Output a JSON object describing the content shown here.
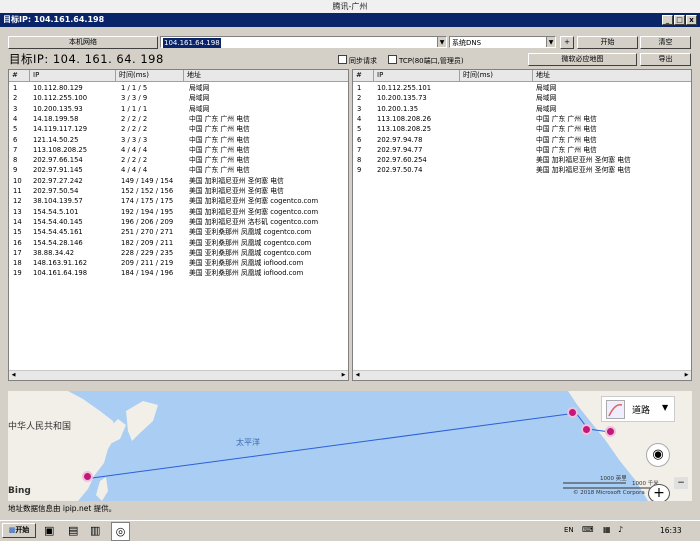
{
  "outer_title": "腾讯-广州",
  "window": {
    "title": "目标IP:  104.161.64.198",
    "controls": [
      "_",
      "□",
      "x"
    ]
  },
  "toolbar": {
    "local_network_label": "本机网络",
    "ip_input_value": "104.161.64.198",
    "dns_select_value": "系统DNS",
    "plus_label": "+",
    "start_label": "开始",
    "clear_label": "清空",
    "bing_map_label": "微软必应地图",
    "export_label": "导出",
    "sync_request_label": "同步请求",
    "tcp_label": "TCP(80端口,管理员)"
  },
  "target_display": "目标IP:  104. 161. 64. 198",
  "left_table": {
    "headers": [
      "#",
      "IP",
      "时间(ms)",
      "地址"
    ],
    "rows": [
      {
        "n": "1",
        "ip": "10.112.80.129",
        "time": "1 / 1 / 5",
        "addr": "局域网"
      },
      {
        "n": "2",
        "ip": "10.112.255.100",
        "time": "3 / 3 / 9",
        "addr": "局域网"
      },
      {
        "n": "3",
        "ip": "10.200.135.93",
        "time": "1 / 1 / 1",
        "addr": "局域网"
      },
      {
        "n": "4",
        "ip": "14.18.199.58",
        "time": "2 / 2 / 2",
        "addr": "中国 广东 广州 电信"
      },
      {
        "n": "5",
        "ip": "14.119.117.129",
        "time": "2 / 2 / 2",
        "addr": "中国 广东 广州 电信"
      },
      {
        "n": "6",
        "ip": "121.14.50.25",
        "time": "3 / 3 / 3",
        "addr": "中国 广东 广州 电信"
      },
      {
        "n": "7",
        "ip": "113.108.208.25",
        "time": "4 / 4 / 4",
        "addr": "中国 广东 广州 电信"
      },
      {
        "n": "8",
        "ip": "202.97.66.154",
        "time": "2 / 2 / 2",
        "addr": "中国 广东 广州 电信"
      },
      {
        "n": "9",
        "ip": "202.97.91.145",
        "time": "4 / 4 / 4",
        "addr": "中国 广东 广州 电信"
      },
      {
        "n": "10",
        "ip": "202.97.27.242",
        "time": "149 / 149 / 154",
        "addr": "美国 加利福尼亚州 圣何塞 电信"
      },
      {
        "n": "11",
        "ip": "202.97.50.54",
        "time": "152 / 152 / 156",
        "addr": "美国 加利福尼亚州 圣何塞 电信"
      },
      {
        "n": "12",
        "ip": "38.104.139.57",
        "time": "174 / 175 / 175",
        "addr": "美国 加利福尼亚州 圣何塞 cogentco.com"
      },
      {
        "n": "13",
        "ip": "154.54.5.101",
        "time": "192 / 194 / 195",
        "addr": "美国 加利福尼亚州 圣何塞 cogentco.com"
      },
      {
        "n": "14",
        "ip": "154.54.40.145",
        "time": "196 / 206 / 209",
        "addr": "美国 加利福尼亚州 洛杉矶 cogentco.com"
      },
      {
        "n": "15",
        "ip": "154.54.45.161",
        "time": "251 / 270 / 271",
        "addr": "美国 亚利桑那州 凤凰城 cogentco.com"
      },
      {
        "n": "16",
        "ip": "154.54.28.146",
        "time": "182 / 209 / 211",
        "addr": "美国 亚利桑那州 凤凰城 cogentco.com"
      },
      {
        "n": "17",
        "ip": "38.88.34.42",
        "time": "228 / 229 / 235",
        "addr": "美国 亚利桑那州 凤凰城 cogentco.com"
      },
      {
        "n": "18",
        "ip": "148.163.91.162",
        "time": "209 / 211 / 219",
        "addr": "美国 亚利桑那州 凤凰城 iofIood.com"
      },
      {
        "n": "19",
        "ip": "104.161.64.198",
        "time": "184 / 194 / 196",
        "addr": "美国 亚利桑那州 凤凰城 iofIood.com"
      }
    ]
  },
  "right_table": {
    "headers": [
      "#",
      "IP",
      "时间(ms)",
      "地址"
    ],
    "rows": [
      {
        "n": "1",
        "ip": "10.112.255.101",
        "time": "",
        "addr": "局域网"
      },
      {
        "n": "2",
        "ip": "10.200.135.73",
        "time": "",
        "addr": "局域网"
      },
      {
        "n": "3",
        "ip": "10.200.1.35",
        "time": "",
        "addr": "局域网"
      },
      {
        "n": "4",
        "ip": "113.108.208.26",
        "time": "",
        "addr": "中国 广东 广州 电信"
      },
      {
        "n": "5",
        "ip": "113.108.208.25",
        "time": "",
        "addr": "中国 广东 广州 电信"
      },
      {
        "n": "6",
        "ip": "202.97.94.78",
        "time": "",
        "addr": "中国 广东 广州 电信"
      },
      {
        "n": "7",
        "ip": "202.97.94.77",
        "time": "",
        "addr": "中国 广东 广州 电信"
      },
      {
        "n": "8",
        "ip": "202.97.60.254",
        "time": "",
        "addr": "美国 加利福尼亚州 圣何塞 电信"
      },
      {
        "n": "9",
        "ip": "202.97.50.74",
        "time": "",
        "addr": "美国 加利福尼亚州 圣何塞 电信"
      }
    ]
  },
  "map": {
    "country_label": "中华人民共和国",
    "ocean_label": "太平洋",
    "layer_label": "道路",
    "bing_label": "Bing",
    "scale_km": "1000 英里",
    "scale_km2": "1000 千米",
    "copyright": "© 2018 Microsoft Corpora",
    "zoom_in": "+",
    "zoom_out": "−"
  },
  "status_text": "地址数据信息由 ipip.net 提供。",
  "taskbar": {
    "start_label": "开始",
    "lang": "EN",
    "clock": "16:33"
  },
  "colors": {
    "title_bar": "#0a246a",
    "map_water": "#a9cdf3",
    "map_land": "#f2efe9",
    "pin": "#c2187a",
    "route": "#2a5fd8"
  }
}
